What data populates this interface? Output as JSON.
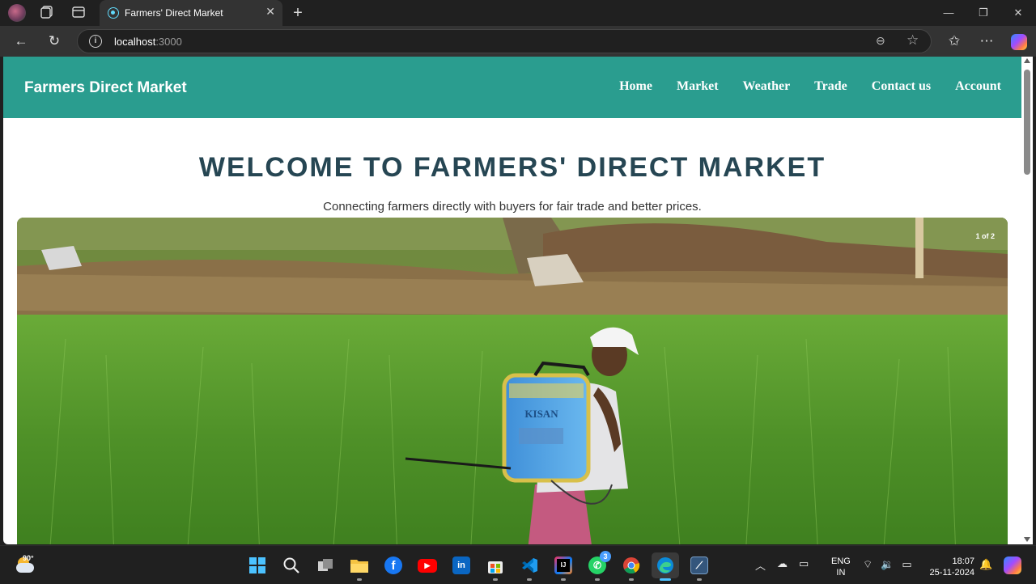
{
  "browser": {
    "tab_title": "Farmers' Direct Market",
    "url_host": "localhost",
    "url_port": ":3000",
    "icons": [
      "profile-icon",
      "collections-icon",
      "tab-actions-icon",
      "close-icon",
      "plus-icon",
      "back-icon",
      "reload-icon",
      "info-icon",
      "zoom-out-icon",
      "star-icon",
      "favorites-icon",
      "more-icon",
      "copilot-icon"
    ]
  },
  "site": {
    "brand": "Farmers Direct Market",
    "nav": [
      "Home",
      "Market",
      "Weather",
      "Trade",
      "Contact us",
      "Account"
    ],
    "hero_title": "WELCOME TO FARMERS' DIRECT MARKET",
    "hero_subtitle": "Connecting farmers directly with buyers for fair trade and better prices.",
    "carousel_counter": "1 of 2",
    "sprayer_text": "KISAN",
    "colors": {
      "nav_bg": "#2a9d8f",
      "title": "#264653"
    }
  },
  "taskbar": {
    "temperature": "90°",
    "whatsapp_badge": "3",
    "language_line1": "ENG",
    "language_line2": "IN",
    "time": "18:07",
    "date": "25-11-2024"
  }
}
